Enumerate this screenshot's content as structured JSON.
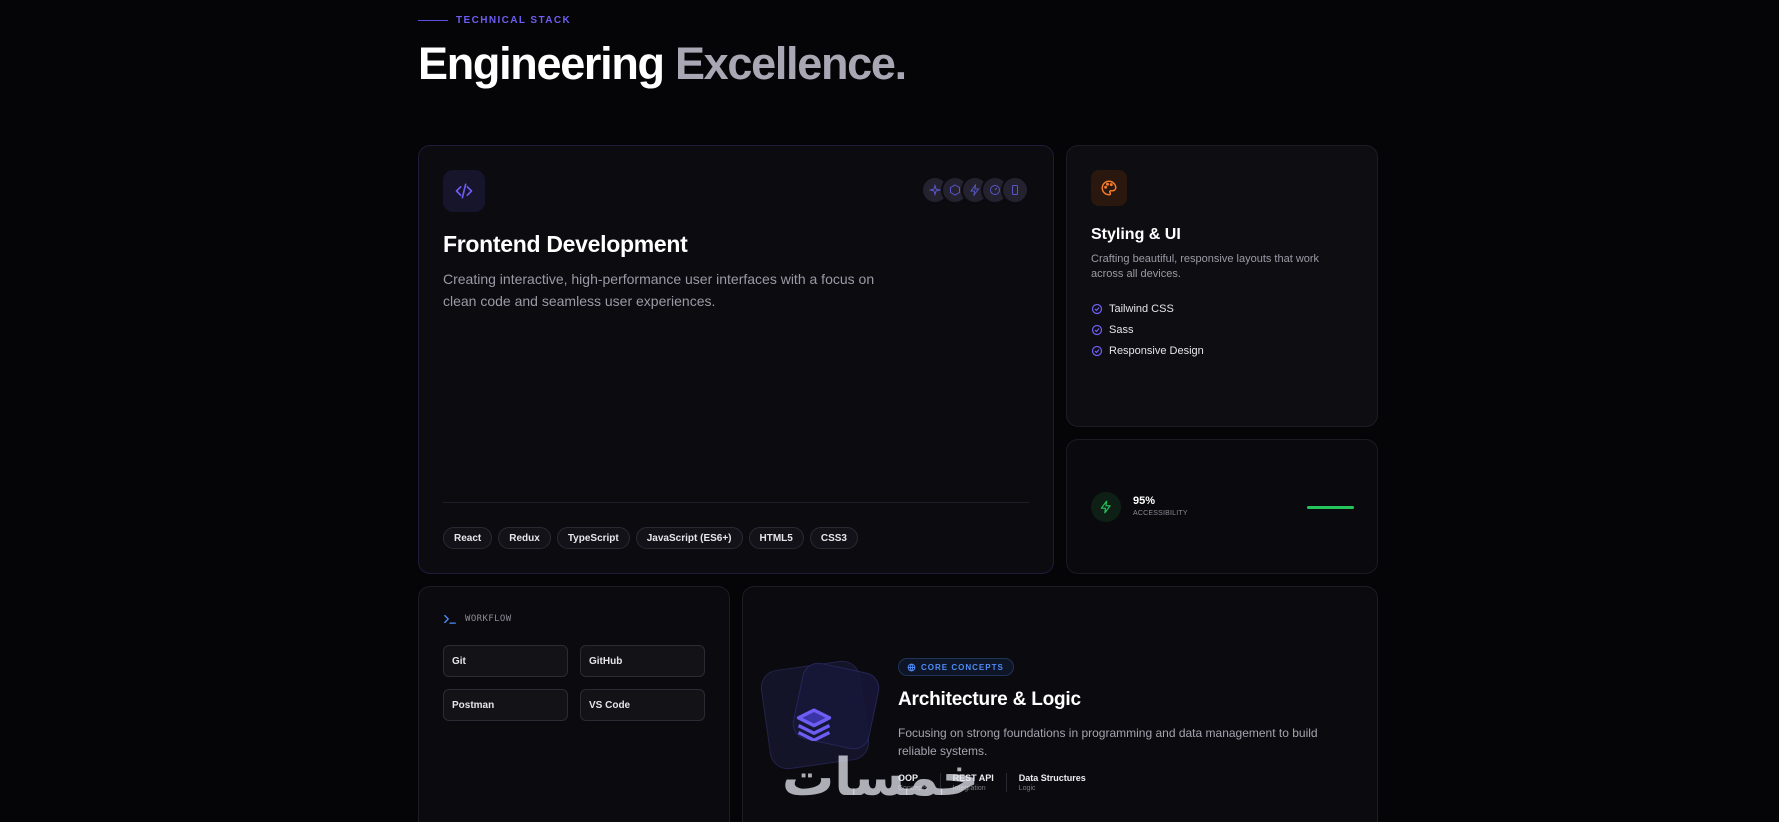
{
  "section": {
    "eyebrow": "TECHNICAL STACK",
    "heading_primary": "Engineering",
    "heading_secondary": "Excellence."
  },
  "frontend": {
    "icon": "code-icon",
    "avatar_icons": [
      "sparkle-icon",
      "hexagon-icon",
      "bolt-icon",
      "gauge-icon",
      "phone-icon"
    ],
    "title": "Frontend Development",
    "description": "Creating interactive, high-performance user interfaces with a focus on clean code and seamless user experiences.",
    "tags": [
      "React",
      "Redux",
      "TypeScript",
      "JavaScript (ES6+)",
      "HTML5",
      "CSS3"
    ]
  },
  "styling": {
    "icon": "palette-icon",
    "title": "Styling & UI",
    "description": "Crafting beautiful, responsive layouts that work across all devices.",
    "items": [
      "Tailwind CSS",
      "Sass",
      "Responsive Design"
    ]
  },
  "metric": {
    "icon": "bolt-icon",
    "value": "95%",
    "label": "ACCESSIBILITY",
    "progress": 1.0
  },
  "workflow": {
    "icon": "terminal-icon",
    "label": "WORKFLOW",
    "tools": [
      "Git",
      "GitHub",
      "Postman",
      "VS Code"
    ]
  },
  "architecture": {
    "icon": "layers-icon",
    "badge": "CORE CONCEPTS",
    "title": "Architecture & Logic",
    "description": "Focusing on strong foundations in programming and data management to build reliable systems.",
    "concepts": [
      {
        "name": "OOP",
        "sub": "Concepts"
      },
      {
        "name": "REST API",
        "sub": "Integration"
      },
      {
        "name": "Data Structures",
        "sub": "Logic"
      }
    ]
  },
  "watermark": "خمسات",
  "colors": {
    "accent": "#6d5df2",
    "orange": "#f47b2a",
    "green": "#25c55b",
    "blue": "#4f8cf5"
  }
}
